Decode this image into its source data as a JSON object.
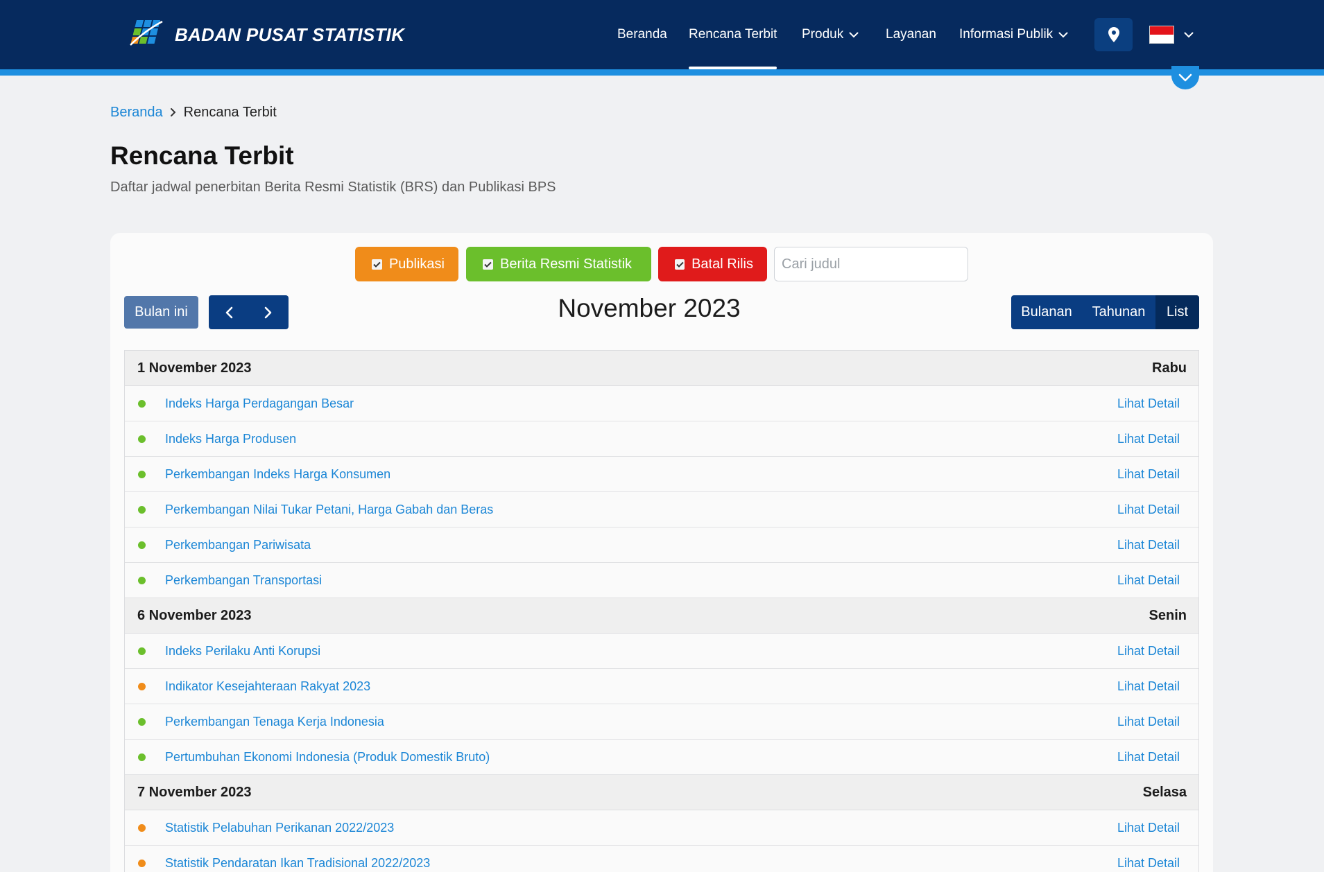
{
  "brand": {
    "name": "BADAN PUSAT STATISTIK"
  },
  "nav": {
    "items": [
      {
        "label": "Beranda"
      },
      {
        "label": "Rencana Terbit"
      },
      {
        "label": "Produk"
      },
      {
        "label": "Layanan"
      },
      {
        "label": "Informasi Publik"
      }
    ],
    "active_item": "Rencana Terbit",
    "icons": [
      "map-pin-icon",
      "indonesia-flag-icon",
      "chevron-down-icon"
    ]
  },
  "breadcrumb": {
    "home": "Beranda",
    "current": "Rencana Terbit"
  },
  "page": {
    "title": "Rencana Terbit",
    "subtitle": "Daftar jadwal penerbitan Berita Resmi Statistik (BRS) dan Publikasi BPS"
  },
  "filters": [
    {
      "label": "Publikasi",
      "checked": true,
      "color": "#f08c1a"
    },
    {
      "label": "Berita Resmi Statistik",
      "checked": true,
      "color": "#6bbf2c"
    },
    {
      "label": "Batal Rilis",
      "checked": true,
      "color": "#e01b1b"
    }
  ],
  "search": {
    "placeholder": "Cari judul",
    "value": ""
  },
  "toolbar": {
    "today_label": "Bulan ini",
    "month_title": "November 2023",
    "views": [
      {
        "label": "Bulanan",
        "active": false
      },
      {
        "label": "Tahunan",
        "active": false
      },
      {
        "label": "List",
        "active": true
      }
    ]
  },
  "colors": {
    "brs": "#6bbf2c",
    "publikasi": "#f08c1a",
    "header": "#062a5e",
    "accent": "#1e8fe0",
    "link": "#1b86d6"
  },
  "days": [
    {
      "date": "1 November 2023",
      "weekday": "Rabu",
      "items": [
        {
          "title": "Indeks Harga Perdagangan Besar",
          "type": "brs",
          "detail": "Lihat Detail"
        },
        {
          "title": "Indeks Harga Produsen",
          "type": "brs",
          "detail": "Lihat Detail"
        },
        {
          "title": "Perkembangan Indeks Harga Konsumen",
          "type": "brs",
          "detail": "Lihat Detail"
        },
        {
          "title": "Perkembangan Nilai Tukar Petani, Harga Gabah dan Beras",
          "type": "brs",
          "detail": "Lihat Detail"
        },
        {
          "title": "Perkembangan Pariwisata",
          "type": "brs",
          "detail": "Lihat Detail"
        },
        {
          "title": "Perkembangan Transportasi",
          "type": "brs",
          "detail": "Lihat Detail"
        }
      ]
    },
    {
      "date": "6 November 2023",
      "weekday": "Senin",
      "items": [
        {
          "title": "Indeks Perilaku Anti Korupsi",
          "type": "brs",
          "detail": "Lihat Detail"
        },
        {
          "title": "Indikator Kesejahteraan Rakyat 2023",
          "type": "publikasi",
          "detail": "Lihat Detail"
        },
        {
          "title": "Perkembangan Tenaga Kerja Indonesia",
          "type": "brs",
          "detail": "Lihat Detail"
        },
        {
          "title": "Pertumbuhan Ekonomi Indonesia (Produk Domestik Bruto)",
          "type": "brs",
          "detail": "Lihat Detail"
        }
      ]
    },
    {
      "date": "7 November 2023",
      "weekday": "Selasa",
      "items": [
        {
          "title": "Statistik Pelabuhan Perikanan 2022/2023",
          "type": "publikasi",
          "detail": "Lihat Detail"
        },
        {
          "title": "Statistik Pendaratan Ikan Tradisional 2022/2023",
          "type": "publikasi",
          "detail": "Lihat Detail"
        }
      ]
    }
  ]
}
